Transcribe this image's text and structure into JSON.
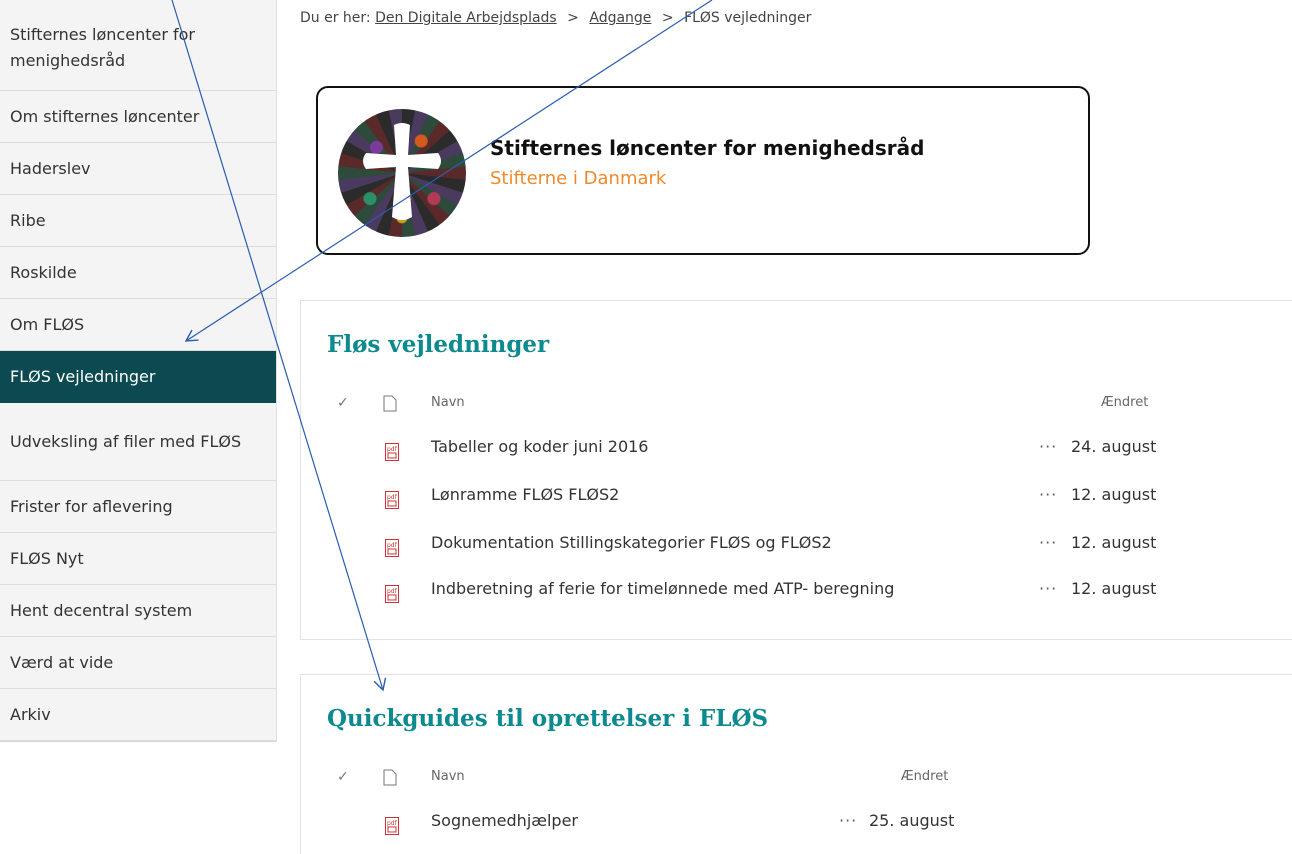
{
  "sidebar": {
    "items": [
      {
        "label": "Stifternes løncenter for menighedsråd"
      },
      {
        "label": "Om stifternes løncenter"
      },
      {
        "label": "Haderslev"
      },
      {
        "label": "Ribe"
      },
      {
        "label": "Roskilde"
      },
      {
        "label": "Om FLØS"
      },
      {
        "label": "FLØS vejledninger"
      },
      {
        "label": "Udveksling af filer med FLØS"
      },
      {
        "label": "Frister for aflevering"
      },
      {
        "label": "FLØS Nyt"
      },
      {
        "label": "Hent decentral system"
      },
      {
        "label": "Værd at vide"
      },
      {
        "label": "Arkiv"
      }
    ]
  },
  "breadcrumb": {
    "prefix": "Du er her:",
    "items": [
      "Den Digitale Arbejdsplads",
      "Adgange",
      "FLØS vejledninger"
    ],
    "separator": ">"
  },
  "banner": {
    "title": "Stifternes løncenter for menighedsråd",
    "subtitle": "Stifterne i Danmark"
  },
  "library1": {
    "title": "Fløs vejledninger",
    "header": {
      "check": "✓",
      "name": "Navn",
      "modified": "Ændret"
    },
    "rows": [
      {
        "name": "Tabeller og koder juni 2016",
        "more": "···",
        "modified": "24. august"
      },
      {
        "name": "Lønramme FLØS FLØS2",
        "more": "···",
        "modified": "12. august"
      },
      {
        "name": "Dokumentation Stillingskategorier FLØS og FLØS2",
        "more": "···",
        "modified": "12. august"
      },
      {
        "name": "Indberetning af ferie for timelønnede med ATP- beregning",
        "more": "···",
        "modified": "12. august"
      }
    ]
  },
  "library2": {
    "title": "Quickguides til oprettelser i FLØS",
    "header": {
      "check": "✓",
      "name": "Navn",
      "modified": "Ændret"
    },
    "rows": [
      {
        "name": "Sognemedhjælper",
        "more": "···",
        "modified": "25. august"
      }
    ]
  },
  "colors": {
    "active_nav": "#0b4a50",
    "section_title": "#0c8a8f",
    "banner_subtitle": "#f0892b",
    "arrow": "#2a5db0"
  }
}
